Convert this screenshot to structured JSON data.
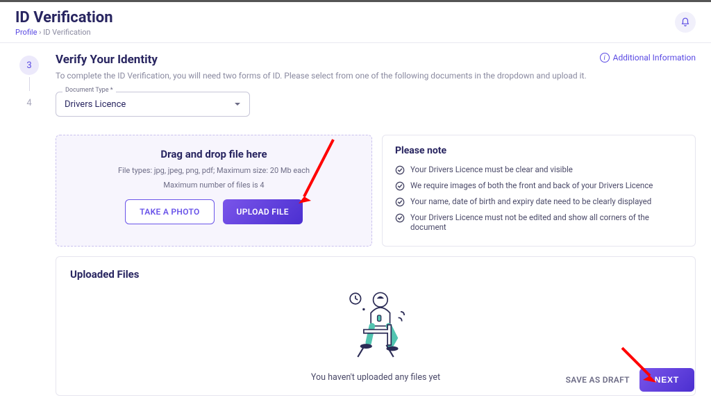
{
  "header": {
    "title": "ID Verification",
    "breadcrumb_root": "Profile",
    "breadcrumb_current": "ID Verification"
  },
  "stepper": {
    "current": "3",
    "next": "4"
  },
  "section": {
    "title": "Verify Your Identity",
    "subtitle": "To complete the ID Verification, you will need two forms of ID. Please select from one of the following documents in the dropdown and upload it.",
    "additional_info": "Additional Information"
  },
  "doc_select": {
    "label": "Document Type *",
    "value": "Drivers Licence"
  },
  "dropzone": {
    "title": "Drag and drop file here",
    "line1": "File types: jpg, jpeg, png, pdf; Maximum size: 20 Mb each",
    "line2": "Maximum number of files is 4",
    "take_photo": "TAKE A PHOTO",
    "upload_file": "UPLOAD FILE"
  },
  "note": {
    "title": "Please note",
    "items": [
      "Your Drivers Licence must be clear and visible",
      "We require images of both the front and back of your Drivers Licence",
      "Your name, date of birth and expiry date need to be clearly displayed",
      "Your Drivers Licence must not be edited and show all corners of the document"
    ]
  },
  "uploads": {
    "title": "Uploaded Files",
    "empty": "You haven't uploaded any files yet"
  },
  "footer": {
    "save_draft": "SAVE AS DRAFT",
    "next": "NEXT"
  }
}
